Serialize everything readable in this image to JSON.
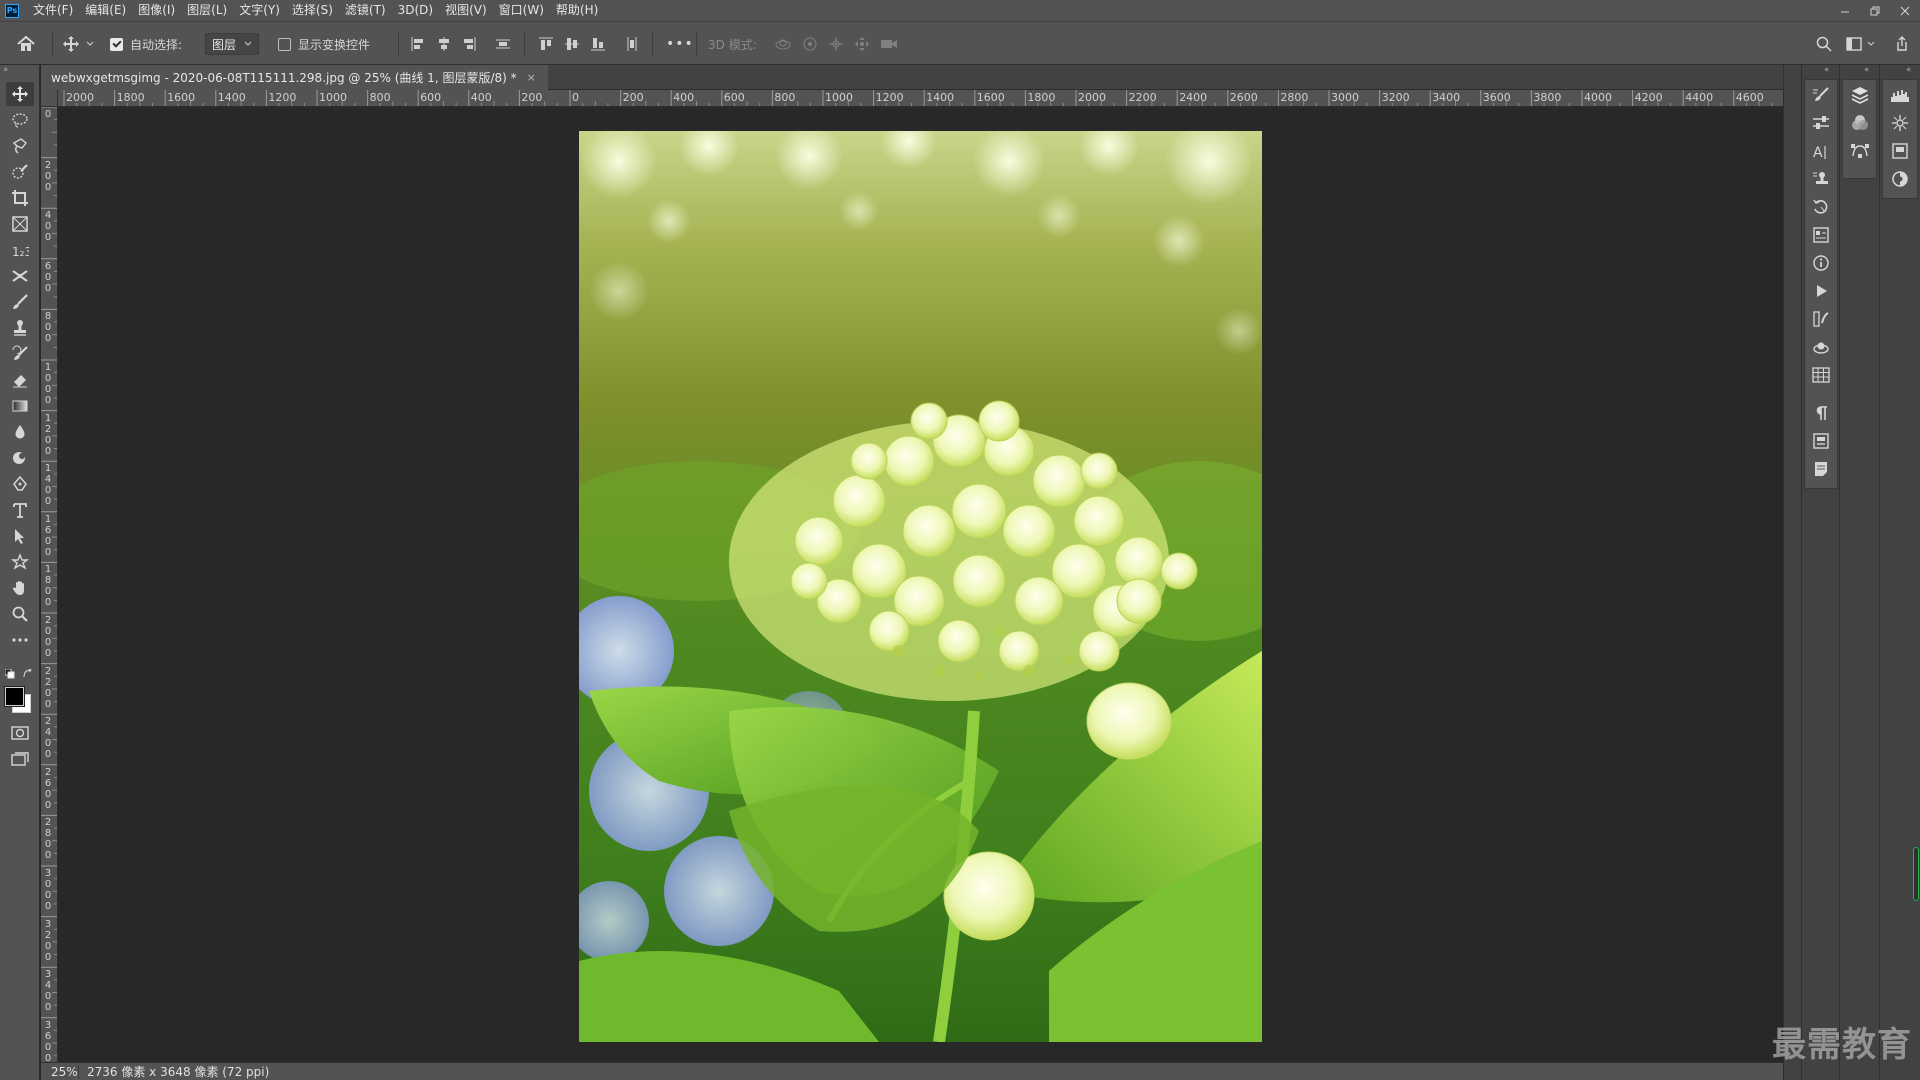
{
  "app": {
    "logo": "Ps",
    "menu": [
      "文件(F)",
      "编辑(E)",
      "图像(I)",
      "图层(L)",
      "文字(Y)",
      "选择(S)",
      "滤镜(T)",
      "3D(D)",
      "视图(V)",
      "窗口(W)",
      "帮助(H)"
    ]
  },
  "options_bar": {
    "auto_select_label": "自动选择:",
    "auto_select_checked": true,
    "auto_select_target": "图层",
    "show_transform_label": "显示变换控件",
    "show_transform_checked": false,
    "more_label": "•••",
    "mode_3d_label": "3D 模式:"
  },
  "document": {
    "tab_title": "webwxgetmsgimg - 2020-06-08T115111.298.jpg @ 25% (曲线 1, 图层蒙版/8) *",
    "close_glyph": "×"
  },
  "ruler": {
    "horizontal_labels": [
      "2000",
      "1800",
      "1600",
      "1400",
      "1200",
      "1000",
      "800",
      "600",
      "400",
      "200",
      "0",
      "200",
      "400",
      "600",
      "800",
      "1000",
      "1200",
      "1400",
      "1600",
      "1800",
      "2000",
      "2200",
      "2400",
      "2600",
      "2800",
      "3000",
      "3200",
      "3400",
      "3600",
      "3800",
      "4000",
      "4200",
      "4400",
      "4600"
    ],
    "vertical_labels": [
      "0",
      "200",
      "400",
      "600",
      "800",
      "1000",
      "1200",
      "1400",
      "1600",
      "1800",
      "2000",
      "2200",
      "2400",
      "2600",
      "2800",
      "3000",
      "3200",
      "3400",
      "3600"
    ]
  },
  "status": {
    "zoom": "25%",
    "doc_info": "2736 像素 x 3648 像素 (72 ppi)"
  },
  "icons": {
    "tools": [
      "move-icon",
      "marquee-icon",
      "lasso-icon",
      "quick-select-icon",
      "crop-icon",
      "frame-icon",
      "eyedropper-icon",
      "healing-icon",
      "brush-icon",
      "clone-stamp-icon",
      "history-brush-icon",
      "eraser-icon",
      "gradient-icon",
      "blur-icon",
      "dodge-icon",
      "pen-icon",
      "type-icon",
      "path-select-icon",
      "shape-icon",
      "hand-icon",
      "zoom-icon",
      "more-tools-icon"
    ],
    "panels_a": [
      "brush-settings-icon",
      "adjustments-icon",
      "character-icon",
      "clone-source-icon",
      "history-icon",
      "properties-icon",
      "info-icon",
      "actions-icon",
      "brush-presets-icon",
      "3d-icon",
      "table-icon",
      "paragraph-icon",
      "layer-comps-icon",
      "notes-icon"
    ],
    "panels_b": [
      "layers-icon",
      "channels-icon",
      "paths-icon"
    ],
    "panels_c": [
      "histogram-icon",
      "navigator-icon",
      "libraries-icon",
      "color-icon"
    ]
  },
  "colors": {
    "foreground": "#000000",
    "background": "#ffffff"
  },
  "watermark": "最需教育"
}
